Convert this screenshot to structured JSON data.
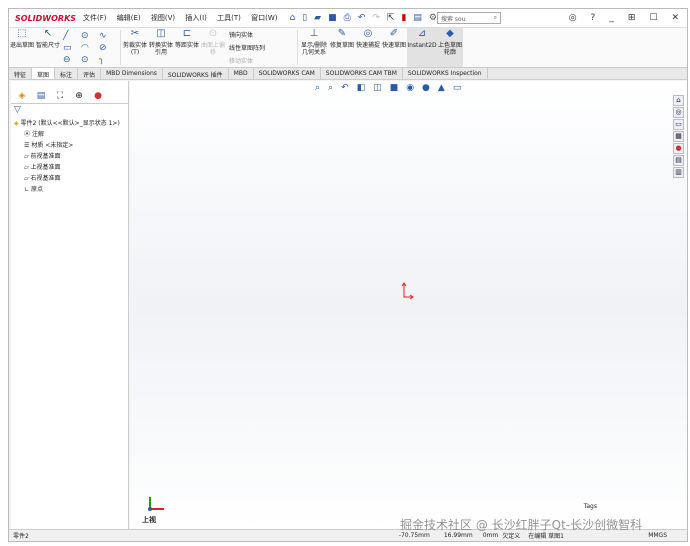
{
  "app": {
    "logo": "SOLIDWORKS"
  },
  "menu": [
    "文件(F)",
    "编辑(E)",
    "视图(V)",
    "插入(I)",
    "工具(T)",
    "窗口(W)"
  ],
  "search": {
    "placeholder": "搜索 sou"
  },
  "ribbon": {
    "exit_sketch": "退出草图",
    "smart_dim": "智能尺寸",
    "trim": "剪裁实体(T)",
    "convert": "转换实体引用",
    "offset": "等距实体",
    "surface_offset": "曲面上偏移",
    "mirror": "镜向实体",
    "linear_pattern": "线性草图阵列",
    "move": "移动实体",
    "display_delete": "显示/删除几何关系",
    "repair": "修复草图",
    "quick_snap": "快速捕捉",
    "rapid_sketch": "快速草图",
    "instant2d": "Instant2D",
    "shaded": "上色草图轮廓"
  },
  "tabs": [
    "特征",
    "草图",
    "标注",
    "评估",
    "MBD Dimensions",
    "SOLIDWORKS 插件",
    "MBD",
    "SOLIDWORKS CAM",
    "SOLIDWORKS CAM TBM",
    "SOLIDWORKS Inspection"
  ],
  "active_tab": 1,
  "tree": {
    "root": "零件2 (默认<<默认>_显示状态 1>)",
    "items": [
      "注解",
      "材质 <未指定>",
      "前视基准面",
      "上视基准面",
      "右视基准面",
      "原点"
    ]
  },
  "view": {
    "label": "上视"
  },
  "status": {
    "doc": "零件2",
    "x": "-70.75mm",
    "y": "16.99mm",
    "z": "0mm",
    "state": "欠定义",
    "editing": "在编辑 草图1",
    "units": "MMGS",
    "tags": "Tags"
  },
  "watermark": "掘金技术社区 @ 长沙红胖子Qt-长沙创微智科"
}
